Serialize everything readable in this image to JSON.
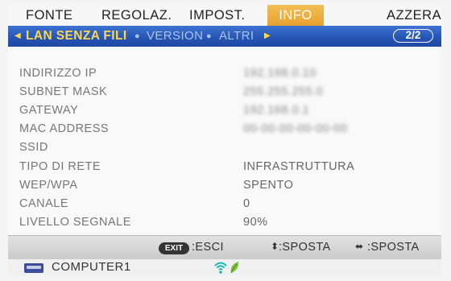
{
  "top_tabs": [
    "FONTE",
    "REGOLAZ.",
    "IMPOST.",
    "INFO",
    "AZZERA"
  ],
  "active_tab": "INFO",
  "subnav": {
    "current": "LAN SENZA FILI",
    "others": [
      "VERSION",
      "ALTRI"
    ],
    "page": "2/2"
  },
  "rows": [
    {
      "label": "INDIRIZZO IP",
      "value": "192.168.0.10"
    },
    {
      "label": "SUBNET MASK",
      "value": "255.255.255.0"
    },
    {
      "label": "GATEWAY",
      "value": "192.168.0.1"
    },
    {
      "label": "MAC ADDRESS",
      "value": "00-00-00-00-00-00"
    },
    {
      "label": "SSID",
      "value": ""
    },
    {
      "label": "TIPO DI RETE",
      "value": "INFRASTRUTTURA"
    },
    {
      "label": "WEP/WPA",
      "value": "SPENTO"
    },
    {
      "label": "CANALE",
      "value": "0"
    },
    {
      "label": "LIVELLO SEGNALE",
      "value": "90%"
    }
  ],
  "hints": {
    "exit_key": "EXIT",
    "exit": ":ESCI",
    "move_vertical": ":SPOSTA",
    "move_horizontal": ":SPOSTA"
  },
  "status": {
    "source": "COMPUTER1",
    "source_icon": "monitor-icon",
    "wireless_icon": "wifi-icon",
    "eco_icon": "leaf-icon"
  },
  "colors": {
    "active_tab": "#e8a530",
    "subnav_bg": "#2a5ab8",
    "current_sub": "#ffd74a"
  }
}
